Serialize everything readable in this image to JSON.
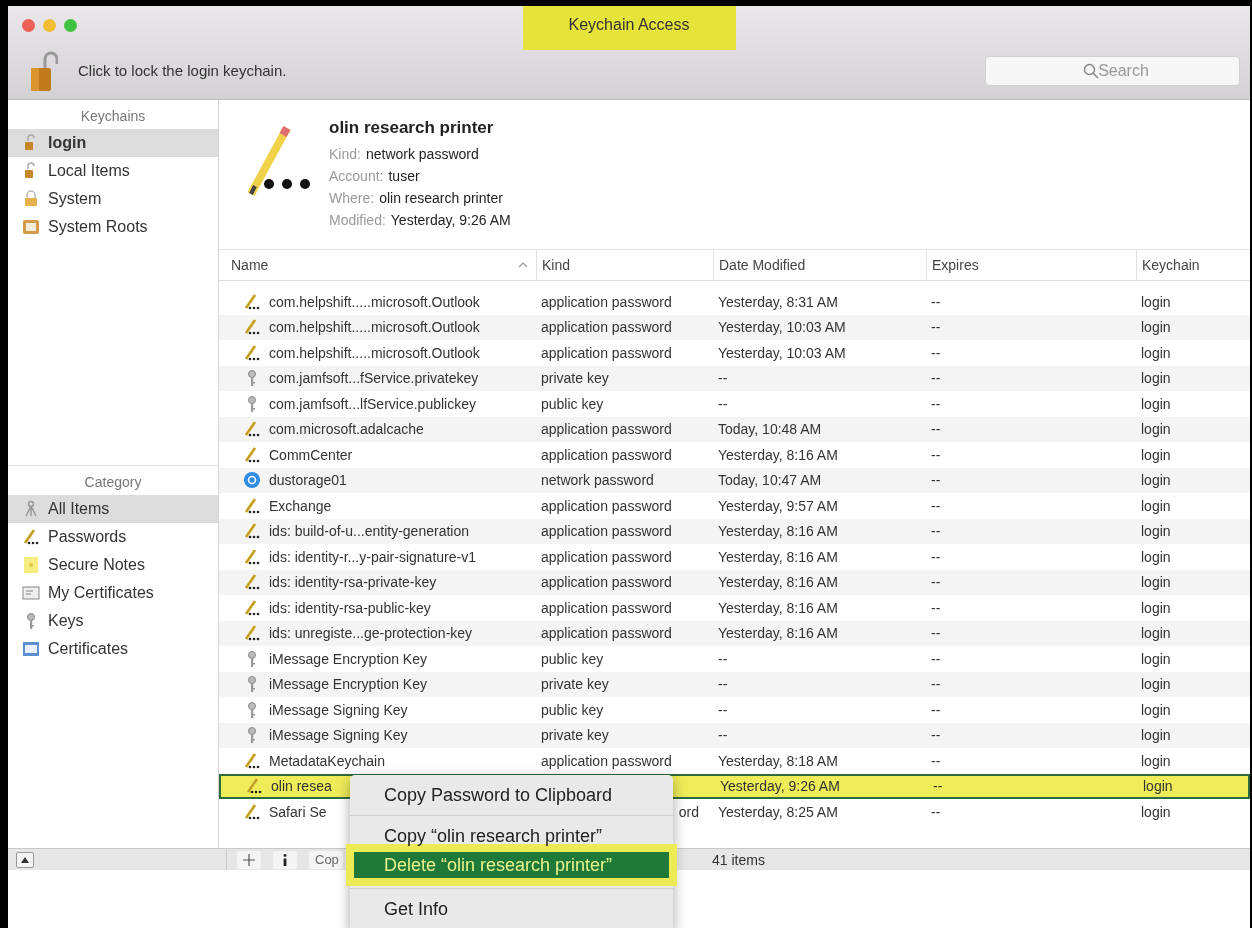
{
  "window": {
    "title": "Keychain Access",
    "title_highlighted": true
  },
  "toolbar": {
    "lock_message": "Click to lock the login keychain.",
    "search": {
      "placeholder": "Search"
    }
  },
  "sidebar": {
    "keychains_header": "Keychains",
    "keychains": [
      {
        "label": "login",
        "kind": "unlocked",
        "selected": true
      },
      {
        "label": "Local Items",
        "kind": "unlocked",
        "selected": false
      },
      {
        "label": "System",
        "kind": "locked",
        "selected": false
      },
      {
        "label": "System Roots",
        "kind": "roots",
        "selected": false
      }
    ],
    "category_header": "Category",
    "categories": [
      {
        "label": "All Items",
        "kind": "all",
        "selected": true
      },
      {
        "label": "Passwords",
        "kind": "passwords",
        "selected": false
      },
      {
        "label": "Secure Notes",
        "kind": "notes",
        "selected": false
      },
      {
        "label": "My Certificates",
        "kind": "mycerts",
        "selected": false
      },
      {
        "label": "Keys",
        "kind": "keys",
        "selected": false
      },
      {
        "label": "Certificates",
        "kind": "certs",
        "selected": false
      }
    ]
  },
  "detail": {
    "title": "olin research printer",
    "fields": [
      {
        "label": "Kind:",
        "value": "network password"
      },
      {
        "label": "Account:",
        "value": "tuser"
      },
      {
        "label": "Where:",
        "value": "olin research printer"
      },
      {
        "label": "Modified:",
        "value": "Yesterday, 9:26 AM"
      }
    ]
  },
  "table": {
    "columns": [
      {
        "label": "Name",
        "sorted": true
      },
      {
        "label": "Kind",
        "sorted": false
      },
      {
        "label": "Date Modified",
        "sorted": false
      },
      {
        "label": "Expires",
        "sorted": false
      },
      {
        "label": "Keychain",
        "sorted": false
      }
    ],
    "rows": [
      {
        "kind": "password",
        "selected": false,
        "covered": false,
        "cells": [
          "com.helpshift.....microsoft.Outlook",
          "application password",
          "Yesterday, 8:31 AM",
          "--",
          "login"
        ]
      },
      {
        "kind": "password",
        "selected": false,
        "covered": false,
        "cells": [
          "com.helpshift.....microsoft.Outlook",
          "application password",
          "Yesterday, 10:03 AM",
          "--",
          "login"
        ]
      },
      {
        "kind": "password",
        "selected": false,
        "covered": false,
        "cells": [
          "com.helpshift.....microsoft.Outlook",
          "application password",
          "Yesterday, 10:03 AM",
          "--",
          "login"
        ]
      },
      {
        "kind": "key",
        "selected": false,
        "covered": false,
        "cells": [
          "com.jamfsoft...fService.privatekey",
          "private key",
          "--",
          "--",
          "login"
        ]
      },
      {
        "kind": "key",
        "selected": false,
        "covered": false,
        "cells": [
          "com.jamfsoft...lfService.publickey",
          "public key",
          "--",
          "--",
          "login"
        ]
      },
      {
        "kind": "password",
        "selected": false,
        "covered": false,
        "cells": [
          "com.microsoft.adalcache",
          "application password",
          "Today, 10:48 AM",
          "--",
          "login"
        ]
      },
      {
        "kind": "password",
        "selected": false,
        "covered": false,
        "cells": [
          "CommCenter",
          "application password",
          "Yesterday, 8:16 AM",
          "--",
          "login"
        ]
      },
      {
        "kind": "network",
        "selected": false,
        "covered": false,
        "cells": [
          "dustorage01",
          "network password",
          "Today, 10:47 AM",
          "--",
          "login"
        ]
      },
      {
        "kind": "password",
        "selected": false,
        "covered": false,
        "cells": [
          "Exchange",
          "application password",
          "Yesterday, 9:57 AM",
          "--",
          "login"
        ]
      },
      {
        "kind": "password",
        "selected": false,
        "covered": false,
        "cells": [
          "ids: build-of-u...entity-generation",
          "application password",
          "Yesterday, 8:16 AM",
          "--",
          "login"
        ]
      },
      {
        "kind": "password",
        "selected": false,
        "covered": false,
        "cells": [
          "ids: identity-r...y-pair-signature-v1",
          "application password",
          "Yesterday, 8:16 AM",
          "--",
          "login"
        ]
      },
      {
        "kind": "password",
        "selected": false,
        "covered": false,
        "cells": [
          "ids: identity-rsa-private-key",
          "application password",
          "Yesterday, 8:16 AM",
          "--",
          "login"
        ]
      },
      {
        "kind": "password",
        "selected": false,
        "covered": false,
        "cells": [
          "ids: identity-rsa-public-key",
          "application password",
          "Yesterday, 8:16 AM",
          "--",
          "login"
        ]
      },
      {
        "kind": "password",
        "selected": false,
        "covered": false,
        "cells": [
          "ids: unregiste...ge-protection-key",
          "application password",
          "Yesterday, 8:16 AM",
          "--",
          "login"
        ]
      },
      {
        "kind": "key",
        "selected": false,
        "covered": false,
        "cells": [
          "iMessage Encryption Key",
          "public key",
          "--",
          "--",
          "login"
        ]
      },
      {
        "kind": "key",
        "selected": false,
        "covered": false,
        "cells": [
          "iMessage Encryption Key",
          "private key",
          "--",
          "--",
          "login"
        ]
      },
      {
        "kind": "key",
        "selected": false,
        "covered": false,
        "cells": [
          "iMessage Signing Key",
          "public key",
          "--",
          "--",
          "login"
        ]
      },
      {
        "kind": "key",
        "selected": false,
        "covered": false,
        "cells": [
          "iMessage Signing Key",
          "private key",
          "--",
          "--",
          "login"
        ]
      },
      {
        "kind": "password",
        "selected": false,
        "covered": false,
        "cells": [
          "MetadataKeychain",
          "application password",
          "Yesterday, 8:18 AM",
          "--",
          "login"
        ]
      },
      {
        "kind": "password",
        "selected": true,
        "covered": false,
        "cells": [
          "olin resea",
          null,
          "Yesterday, 9:26 AM",
          "--",
          "login"
        ]
      },
      {
        "kind": "password",
        "selected": false,
        "covered": true,
        "cells": [
          "Safari Se",
          "ord",
          "Yesterday, 8:25 AM",
          "--",
          "login"
        ]
      }
    ]
  },
  "bottom_bar": {
    "partial_button": "Cop",
    "count": "41 items"
  },
  "context_menu": {
    "items": [
      {
        "kind": "item",
        "label": "Copy Password to Clipboard",
        "selected": false
      },
      {
        "kind": "separator"
      },
      {
        "kind": "item",
        "label": "Copy “olin research printer”",
        "selected": false
      },
      {
        "kind": "item",
        "label": "Delete “olin research printer”",
        "selected": true
      },
      {
        "kind": "separator"
      },
      {
        "kind": "item",
        "label": "Get Info",
        "selected": false
      }
    ]
  }
}
